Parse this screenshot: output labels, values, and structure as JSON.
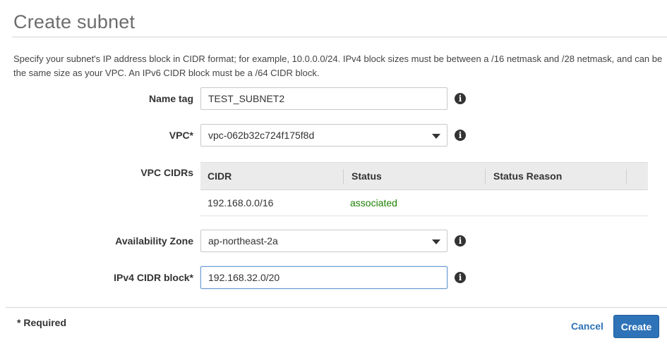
{
  "header": {
    "title": "Create subnet"
  },
  "description": "Specify your subnet's IP address block in CIDR format; for example, 10.0.0.0/24. IPv4 block sizes must be between a /16 netmask and /28 netmask, and can be the same size as your VPC. An IPv6 CIDR block must be a /64 CIDR block.",
  "form": {
    "name_tag": {
      "label": "Name tag",
      "value": "TEST_SUBNET2"
    },
    "vpc": {
      "label": "VPC*",
      "value": "vpc-062b32c724f175f8d"
    },
    "vpc_cidrs": {
      "label": "VPC CIDRs",
      "columns": [
        "CIDR",
        "Status",
        "Status Reason"
      ],
      "rows": [
        {
          "cidr": "192.168.0.0/16",
          "status": "associated",
          "status_reason": ""
        }
      ]
    },
    "availability_zone": {
      "label": "Availability Zone",
      "value": "ap-northeast-2a"
    },
    "ipv4_cidr": {
      "label": "IPv4 CIDR block*",
      "value": "192.168.32.0/20"
    }
  },
  "footer": {
    "required_note": "* Required",
    "cancel_label": "Cancel",
    "create_label": "Create"
  },
  "icons": {
    "info": "info-icon",
    "dropdown": "chevron-down-icon"
  },
  "colors": {
    "accent": "#2e73b8",
    "status_ok": "#1d8102"
  }
}
